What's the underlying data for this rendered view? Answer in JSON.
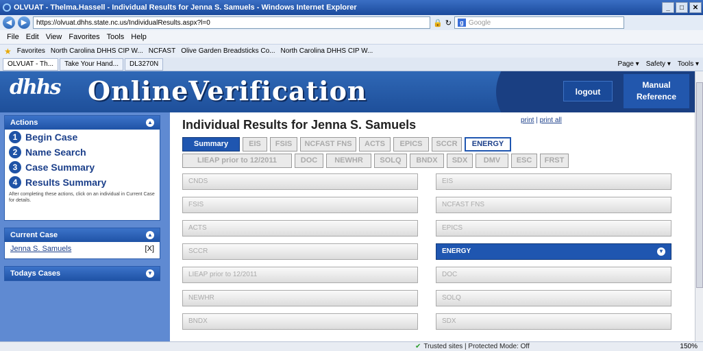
{
  "window": {
    "title": "OLVUAT - Thelma.Hassell - Individual Results for Jenna S. Samuels - Windows Internet Explorer"
  },
  "browser": {
    "address": "https://olvuat.dhhs.state.nc.us/IndividualResults.aspx?l=0",
    "search_placeholder": "Google",
    "menu": [
      "File",
      "Edit",
      "View",
      "Favorites",
      "Tools",
      "Help"
    ],
    "favorites_label": "Favorites",
    "favorites": [
      "North Carolina DHHS CIP W...",
      "NCFAST",
      "Olive Garden Breadsticks Co...",
      "North Carolina DHHS CIP W..."
    ],
    "tabs": [
      "OLVUAT - Th...",
      "Take Your Hand...",
      "DL3270N"
    ],
    "tools": [
      "Page ▾",
      "Safety ▾",
      "Tools ▾"
    ],
    "status": "Trusted sites | Protected Mode: Off",
    "zoom": "150%"
  },
  "header": {
    "logo": "dhhs",
    "app_title": "OnlineVerification",
    "logout": "logout",
    "manual_line1": "Manual",
    "manual_line2": "Reference"
  },
  "sidebar": {
    "actions_title": "Actions",
    "steps": [
      {
        "num": "1",
        "label": "Begin Case"
      },
      {
        "num": "2",
        "label": "Name Search"
      },
      {
        "num": "3",
        "label": "Case Summary"
      },
      {
        "num": "4",
        "label": "Results Summary"
      }
    ],
    "note": "After completing these actions, click on an individual in Current Case for details.",
    "current_case_title": "Current Case",
    "current_case_name": "Jenna S. Samuels",
    "current_case_remove": "[X]",
    "todays_cases_title": "Todays Cases"
  },
  "main": {
    "title": "Individual Results for Jenna S. Samuels",
    "print": "print",
    "separator": "|",
    "print_all": "print all",
    "tabs_row1": [
      "Summary",
      "EIS",
      "FSIS",
      "NCFAST FNS",
      "ACTS",
      "EPICS",
      "SCCR",
      "ENERGY"
    ],
    "tabs_row2": [
      "LIEAP prior to 12/2011",
      "DOC",
      "NEWHR",
      "SOLQ",
      "BNDX",
      "SDX",
      "DMV",
      "ESC",
      "FRST"
    ],
    "sources_left": [
      "CNDS",
      "FSIS",
      "ACTS",
      "SCCR",
      "LIEAP prior to 12/2011",
      "NEWHR",
      "BNDX"
    ],
    "sources_right": [
      "EIS",
      "NCFAST FNS",
      "EPICS",
      "ENERGY",
      "DOC",
      "SOLQ",
      "SDX"
    ]
  }
}
